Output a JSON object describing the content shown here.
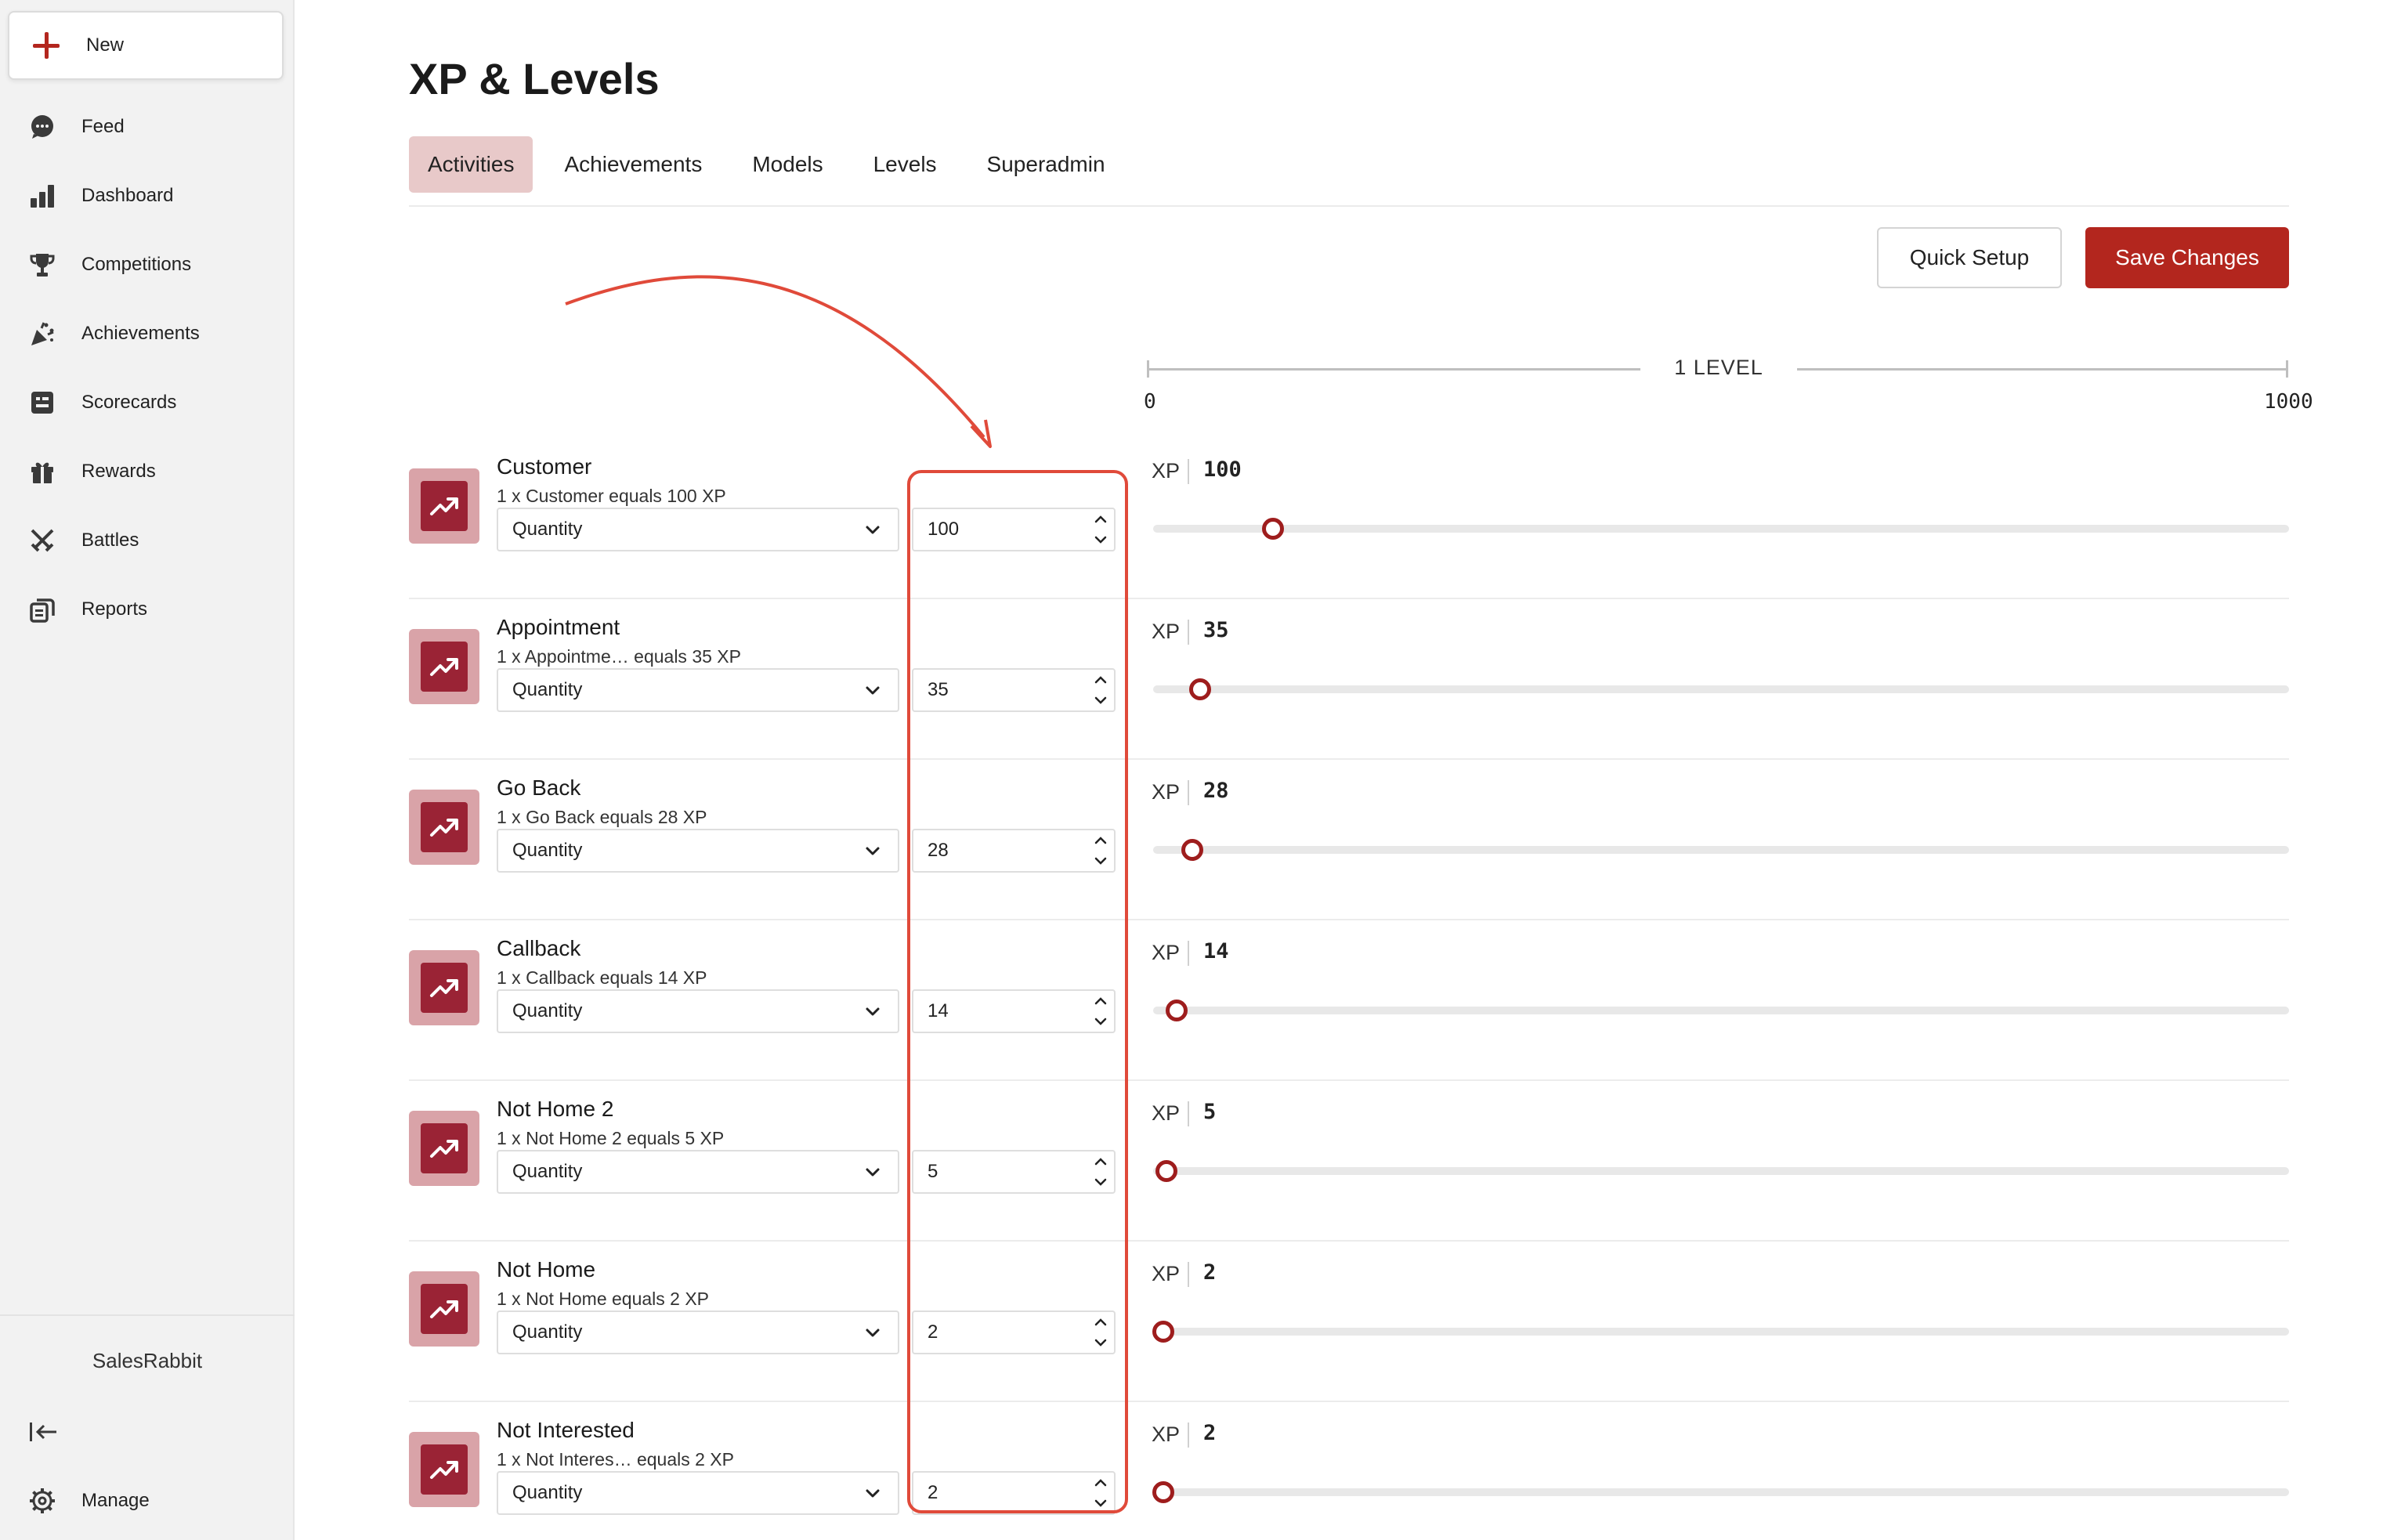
{
  "sidebar": {
    "new_label": "New",
    "items": [
      {
        "label": "Feed",
        "icon": "chat-bubble-icon"
      },
      {
        "label": "Dashboard",
        "icon": "bar-chart-icon"
      },
      {
        "label": "Competitions",
        "icon": "trophy-icon"
      },
      {
        "label": "Achievements",
        "icon": "party-popper-icon"
      },
      {
        "label": "Scorecards",
        "icon": "scorecard-icon"
      },
      {
        "label": "Rewards",
        "icon": "gift-icon"
      },
      {
        "label": "Battles",
        "icon": "crossed-swords-icon"
      },
      {
        "label": "Reports",
        "icon": "reports-icon"
      }
    ],
    "brand": "SalesRabbit",
    "manage_label": "Manage"
  },
  "page": {
    "title": "XP & Levels",
    "tabs": [
      {
        "label": "Activities",
        "active": true
      },
      {
        "label": "Achievements",
        "active": false
      },
      {
        "label": "Models",
        "active": false
      },
      {
        "label": "Levels",
        "active": false
      },
      {
        "label": "Superadmin",
        "active": false
      }
    ],
    "quick_setup_label": "Quick Setup",
    "save_label": "Save Changes"
  },
  "level_scale": {
    "label": "1 LEVEL",
    "min": "0",
    "max": "1000",
    "max_value": 1000
  },
  "xp_label": "XP",
  "activities": [
    {
      "name": "Customer",
      "description": "1 x Customer equals 100 XP",
      "type": "Quantity",
      "value": "100",
      "xp": 100
    },
    {
      "name": "Appointment",
      "description": "1 x Appointme… equals 35 XP",
      "type": "Quantity",
      "value": "35",
      "xp": 35
    },
    {
      "name": "Go Back",
      "description": "1 x Go Back equals 28 XP",
      "type": "Quantity",
      "value": "28",
      "xp": 28
    },
    {
      "name": "Callback",
      "description": "1 x Callback equals 14 XP",
      "type": "Quantity",
      "value": "14",
      "xp": 14
    },
    {
      "name": "Not Home 2",
      "description": "1 x Not Home 2 equals 5 XP",
      "type": "Quantity",
      "value": "5",
      "xp": 5
    },
    {
      "name": "Not Home",
      "description": "1 x Not Home equals 2 XP",
      "type": "Quantity",
      "value": "2",
      "xp": 2
    },
    {
      "name": "Not Interested",
      "description": "1 x Not Interes… equals 2 XP",
      "type": "Quantity",
      "value": "2",
      "xp": 2
    }
  ],
  "colors": {
    "accent": "#b3261e",
    "tab_active_bg": "#e8c9c9",
    "icon_tile_bg": "#d9a3a8",
    "icon_tile_inner": "#9a2335",
    "annotation": "#e04a3a"
  }
}
